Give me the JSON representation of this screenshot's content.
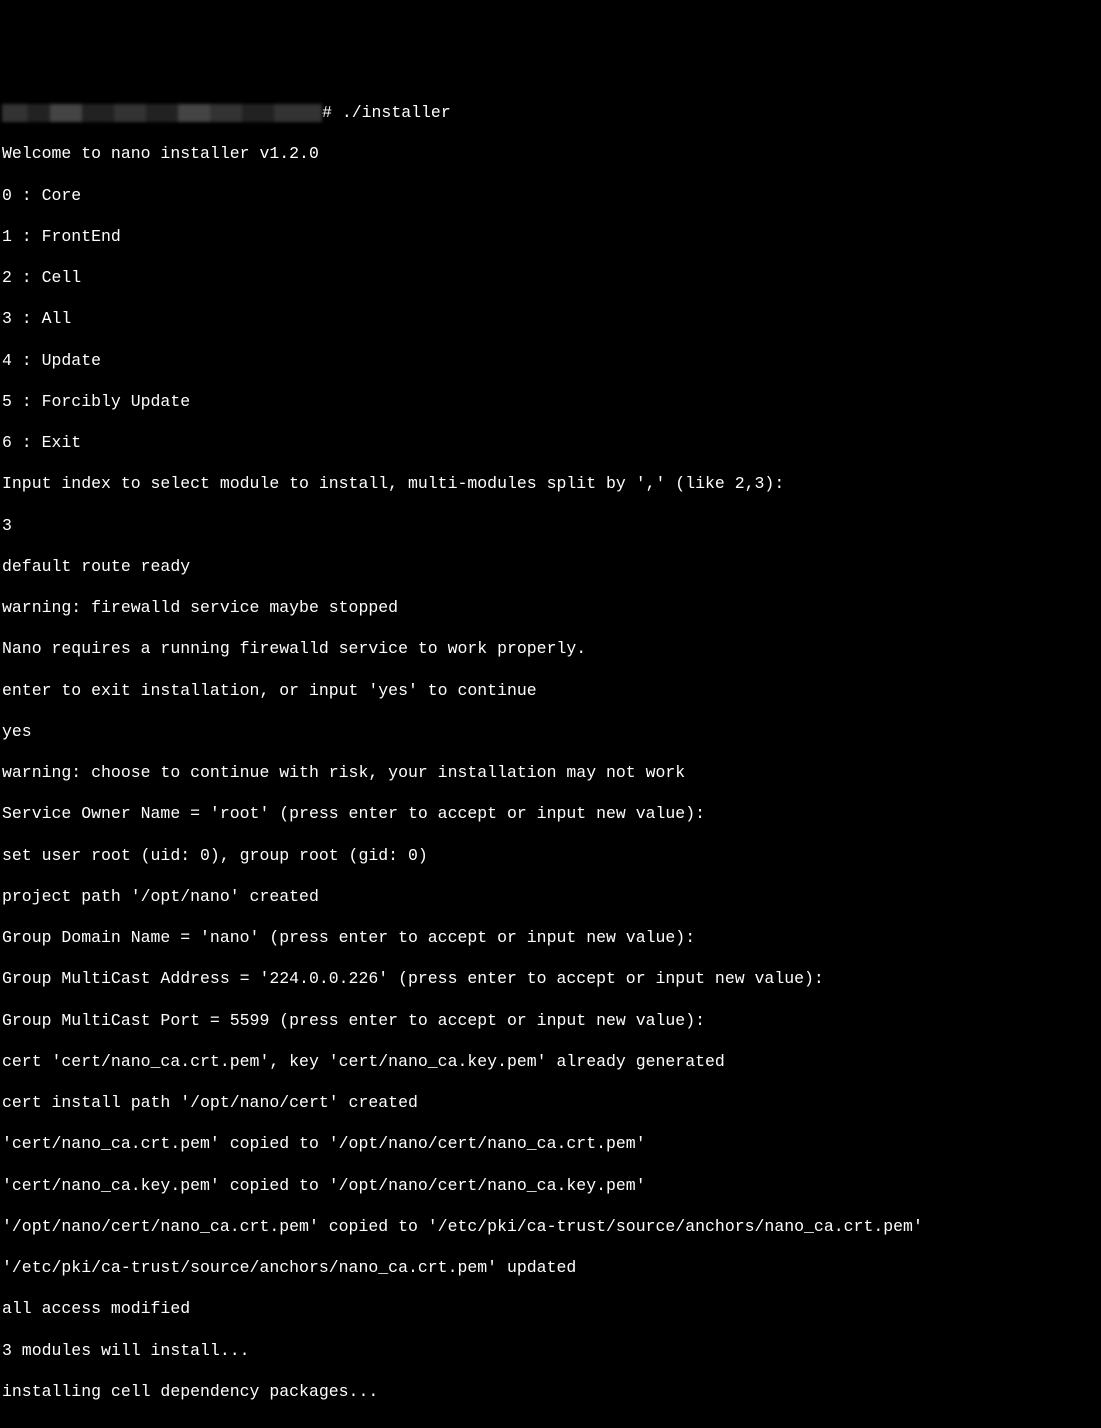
{
  "prompt": {
    "hash": "#",
    "command": "./installer"
  },
  "lines": [
    "Welcome to nano installer v1.2.0",
    "0 : Core",
    "1 : FrontEnd",
    "2 : Cell",
    "3 : All",
    "4 : Update",
    "5 : Forcibly Update",
    "6 : Exit",
    "Input index to select module to install, multi-modules split by ',' (like 2,3):",
    "3",
    "default route ready",
    "warning: firewalld service maybe stopped",
    "Nano requires a running firewalld service to work properly.",
    "enter to exit installation, or input 'yes' to continue",
    "yes",
    "warning: choose to continue with risk, your installation may not work",
    "Service Owner Name = 'root' (press enter to accept or input new value):",
    "set user root (uid: 0), group root (gid: 0)",
    "project path '/opt/nano' created",
    "Group Domain Name = 'nano' (press enter to accept or input new value):",
    "Group MultiCast Address = '224.0.0.226' (press enter to accept or input new value):",
    "Group MultiCast Port = 5599 (press enter to accept or input new value):",
    "cert 'cert/nano_ca.crt.pem', key 'cert/nano_ca.key.pem' already generated",
    "cert install path '/opt/nano/cert' created",
    "'cert/nano_ca.crt.pem' copied to '/opt/nano/cert/nano_ca.crt.pem'",
    "'cert/nano_ca.key.pem' copied to '/opt/nano/cert/nano_ca.key.pem'",
    "'/opt/nano/cert/nano_ca.crt.pem' copied to '/etc/pki/ca-trust/source/anchors/nano_ca.crt.pem'",
    "'/etc/pki/ca-trust/source/anchors/nano_ca.crt.pem' updated",
    "all access modified",
    "3 modules will install...",
    "installing cell dependency packages..."
  ]
}
